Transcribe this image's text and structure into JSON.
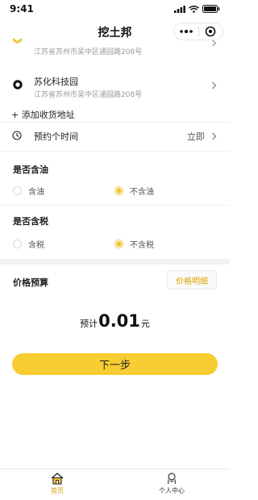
{
  "status_bar": {
    "time": "9:41"
  },
  "nav": {
    "title": "挖土邦"
  },
  "addresses": [
    {
      "name": "",
      "detail": "江苏省苏州市吴中区通园路208号"
    },
    {
      "name": "苏化科技园",
      "detail": "江苏省苏州市吴中区通园路208号"
    }
  ],
  "add_address": "+ 添加收货地址",
  "schedule": {
    "label": "预约个时间",
    "value": "立即"
  },
  "oil": {
    "title": "是否含油",
    "options": [
      "含油",
      "不含油"
    ],
    "selected": "不含油"
  },
  "tax": {
    "title": "是否含税",
    "options": [
      "含税",
      "不含税"
    ],
    "selected": "不含税"
  },
  "budget": {
    "title": "价格预算",
    "detail_button": "价格明细",
    "prefix": "预计",
    "amount": "0.01",
    "unit": "元"
  },
  "next_button": "下一步",
  "tabs": [
    {
      "label": "首页",
      "icon": "home-icon",
      "active": true
    },
    {
      "label": "个人中心",
      "icon": "user-icon",
      "active": false
    }
  ],
  "colors": {
    "accent": "#f7cd32",
    "accent_text": "#e0a400",
    "muted": "#999999"
  }
}
